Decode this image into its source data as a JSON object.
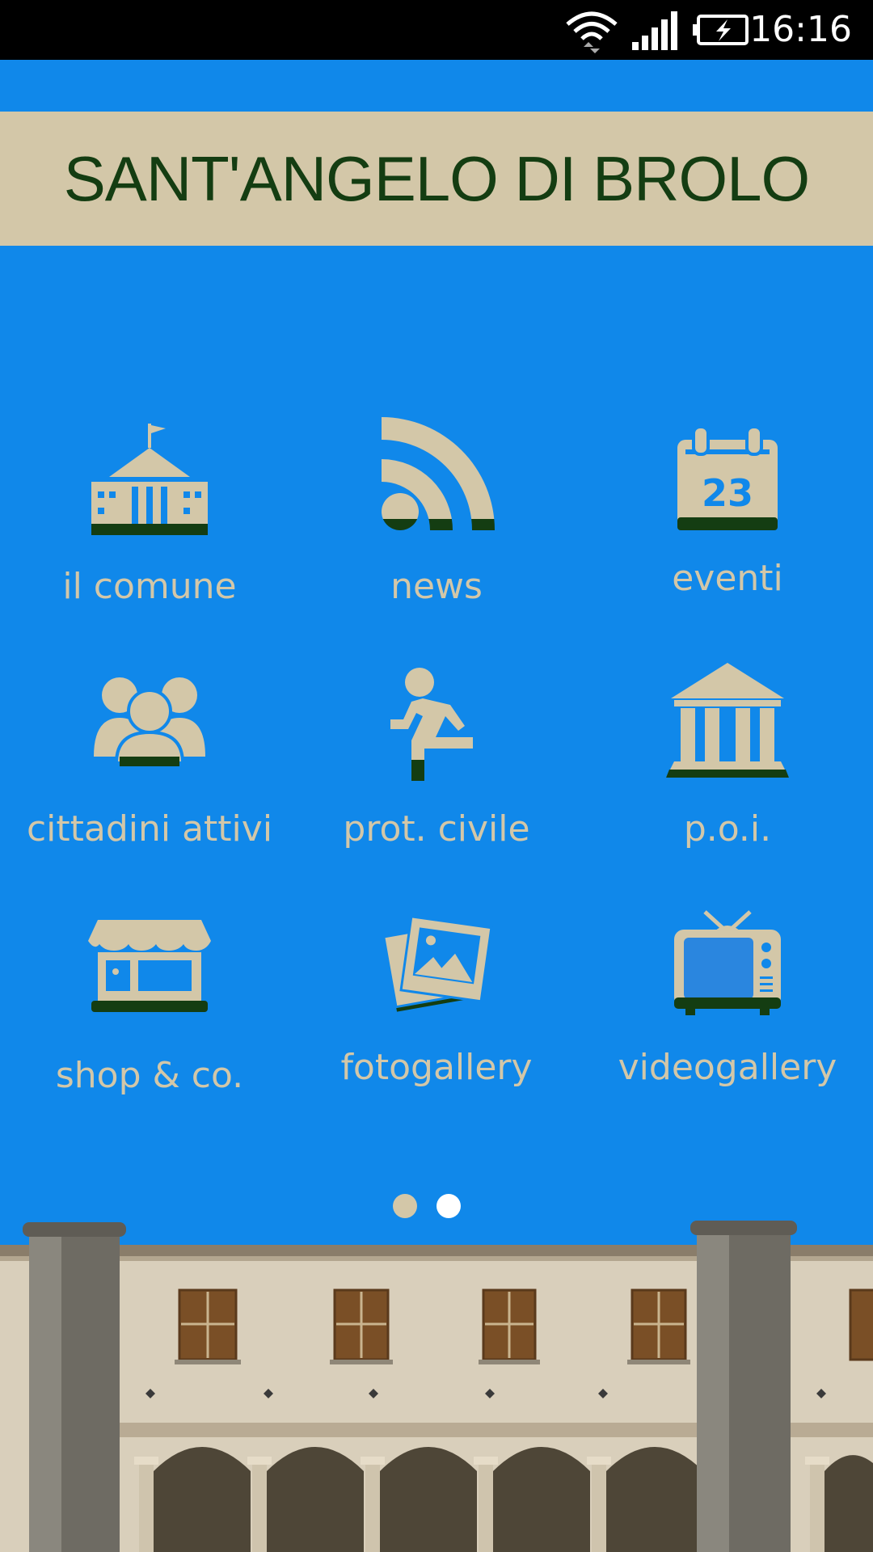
{
  "status_bar": {
    "time": "16:16",
    "icons": [
      "wifi-icon",
      "signal-icon",
      "battery-charging-icon"
    ]
  },
  "header": {
    "title": "SANT'ANGELO DI BROLO"
  },
  "menu": {
    "items": [
      {
        "label": "il comune",
        "icon": "town-hall-icon"
      },
      {
        "label": "news",
        "icon": "rss-icon"
      },
      {
        "label": "eventi",
        "icon": "calendar-icon",
        "icon_text": "23"
      },
      {
        "label": "cittadini attivi",
        "icon": "people-icon"
      },
      {
        "label": "prot. civile",
        "icon": "emergency-exit-icon"
      },
      {
        "label": "p.o.i.",
        "icon": "monument-icon"
      },
      {
        "label": "shop & co.",
        "icon": "shop-icon"
      },
      {
        "label": "fotogallery",
        "icon": "photos-icon"
      },
      {
        "label": "videogallery",
        "icon": "tv-icon"
      }
    ]
  },
  "pager": {
    "pages": 2,
    "current": 2
  },
  "colors": {
    "background": "#1088ea",
    "beige": "#d3c7a8",
    "dark_green": "#143d12",
    "status_bar": "#000000"
  }
}
